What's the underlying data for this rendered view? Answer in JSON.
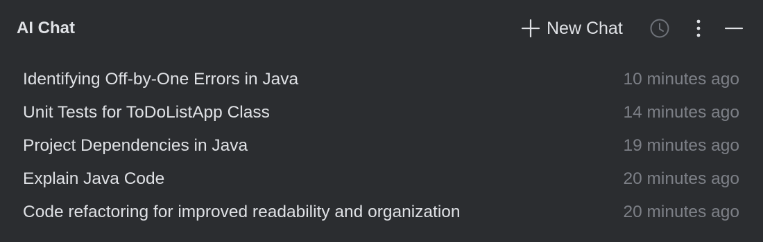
{
  "panel": {
    "title": "AI Chat",
    "new_chat_label": "New Chat",
    "icons": {
      "new_chat": "plus-icon",
      "history": "clock-icon",
      "more": "vertical-ellipsis-icon",
      "minimize": "minus-icon"
    }
  },
  "chats": [
    {
      "title": "Identifying Off-by-One Errors in Java",
      "time": "10 minutes ago"
    },
    {
      "title": "Unit Tests for ToDoListApp Class",
      "time": "14 minutes ago"
    },
    {
      "title": "Project Dependencies in Java",
      "time": "19 minutes ago"
    },
    {
      "title": "Explain Java Code",
      "time": "20 minutes ago"
    },
    {
      "title": "Code refactoring for improved readability and organization",
      "time": "20 minutes ago"
    }
  ],
  "colors": {
    "background": "#2b2d30",
    "text": "#dfe1e5",
    "muted_text": "#7d8087",
    "disabled_icon": "#6f737a"
  }
}
